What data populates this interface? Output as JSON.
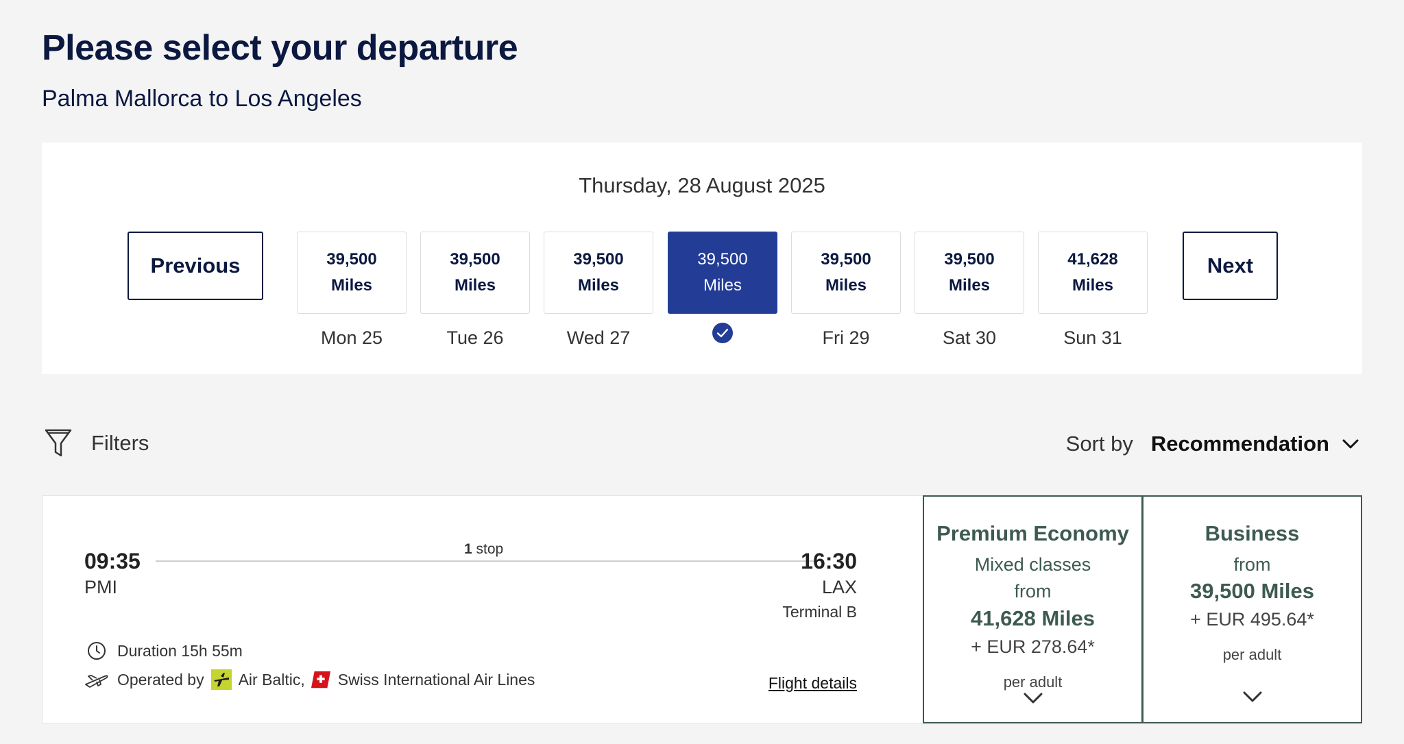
{
  "header": {
    "title": "Please select your departure",
    "route": "Palma Mallorca to Los Angeles"
  },
  "date_selector": {
    "selected_date": "Thursday, 28 August 2025",
    "previous_label": "Previous",
    "next_label": "Next",
    "days": [
      {
        "miles": "39,500",
        "unit": "Miles",
        "label": "Mon 25",
        "selected": false
      },
      {
        "miles": "39,500",
        "unit": "Miles",
        "label": "Tue 26",
        "selected": false
      },
      {
        "miles": "39,500",
        "unit": "Miles",
        "label": "Wed 27",
        "selected": false
      },
      {
        "miles": "39,500",
        "unit": "Miles",
        "label": "",
        "selected": true
      },
      {
        "miles": "39,500",
        "unit": "Miles",
        "label": "Fri 29",
        "selected": false
      },
      {
        "miles": "39,500",
        "unit": "Miles",
        "label": "Sat 30",
        "selected": false
      },
      {
        "miles": "41,628",
        "unit": "Miles",
        "label": "Sun 31",
        "selected": false
      }
    ],
    "accent_color": "#233d96"
  },
  "toolbar": {
    "filters_label": "Filters",
    "sort_label": "Sort by",
    "sort_value": "Recommendation"
  },
  "flight": {
    "departure_time": "09:35",
    "departure_code": "PMI",
    "arrival_time": "16:30",
    "arrival_code": "LAX",
    "arrival_terminal": "Terminal B",
    "stops_count": "1",
    "stops_word": "stop",
    "duration": "Duration 15h 55m",
    "operated_by": "Operated by",
    "airlines": [
      "Air Baltic,",
      "Swiss International Air Lines"
    ],
    "details_link": "Flight details"
  },
  "fares": {
    "premium_economy": {
      "name": "Premium Economy",
      "note": "Mixed classes",
      "from": "from",
      "miles": "41,628 Miles",
      "eur": "+ EUR 278.64*",
      "per": "per adult"
    },
    "business": {
      "name": "Business",
      "from": "from",
      "miles": "39,500 Miles",
      "eur": "+ EUR 495.64*",
      "per": "per adult"
    },
    "color": "#3d5a52"
  }
}
